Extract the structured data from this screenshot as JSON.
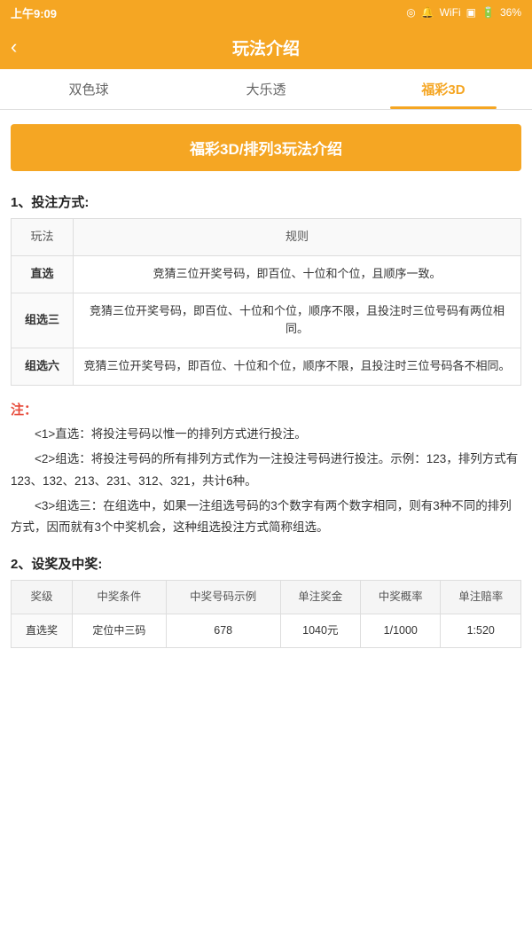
{
  "statusBar": {
    "time": "上午9:09",
    "battery": "36%"
  },
  "header": {
    "back": "‹",
    "title": "玩法介绍"
  },
  "tabs": [
    {
      "id": "tab-双色球",
      "label": "双色球",
      "active": false
    },
    {
      "id": "tab-大乐透",
      "label": "大乐透",
      "active": false
    },
    {
      "id": "tab-福彩3D",
      "label": "福彩3D",
      "active": true
    }
  ],
  "banner": {
    "text": "福彩3D/排列3玩法介绍"
  },
  "section1": {
    "heading": "1、投注方式:",
    "tableHeader": [
      "玩法",
      "规则"
    ],
    "tableRows": [
      {
        "name": "直选",
        "rule": "竞猜三位开奖号码，即百位、十位和个位，且顺序一致。"
      },
      {
        "name": "组选三",
        "rule": "竞猜三位开奖号码，即百位、十位和个位，顺序不限，且投注时三位号码有两位相同。"
      },
      {
        "name": "组选六",
        "rule": "竞猜三位开奖号码，即百位、十位和个位，顺序不限，且投注时三位号码各不相同。"
      }
    ]
  },
  "note": {
    "title": "注：",
    "lines": [
      "<1>直选：将投注号码以惟一的排列方式进行投注。",
      "<2>组选：将投注号码的所有排列方式作为一注投注号码进行投注。示例：123，排列方式有123、132、213、231、312、321，共计6种。",
      "<3>组选三：在组选中，如果一注组选号码的3个数字有两个数字相同，则有3种不同的排列方式，因而就有3个中奖机会，这种组选投注方式简称组选。"
    ]
  },
  "section2": {
    "heading": "2、设奖及中奖:",
    "tableHeaders": [
      "奖级",
      "中奖条件",
      "中奖号码示例",
      "单注奖金",
      "中奖概率",
      "单注赔率"
    ],
    "tableRows": [
      {
        "level": "直选奖",
        "condition": "定位中三码",
        "example": "678",
        "prize": "1040元",
        "probability": "1/1000",
        "ratio": "1:520"
      }
    ]
  }
}
